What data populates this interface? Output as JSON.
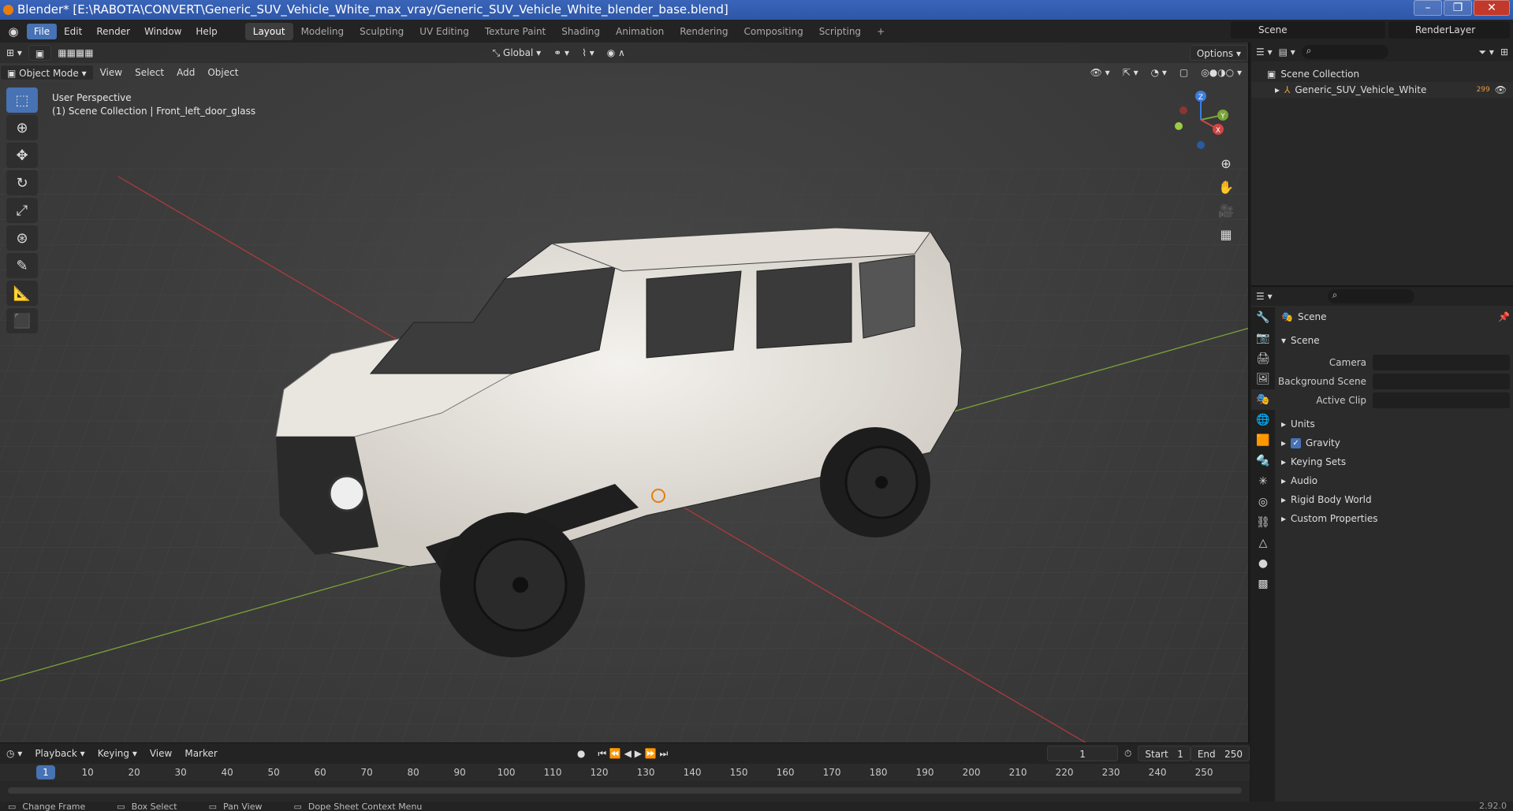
{
  "titlebar": {
    "title": "Blender* [E:\\RABOTA\\CONVERT\\Generic_SUV_Vehicle_White_max_vray/Generic_SUV_Vehicle_White_blender_base.blend]"
  },
  "menu": [
    "File",
    "Edit",
    "Render",
    "Window",
    "Help"
  ],
  "workspaces": [
    "Layout",
    "Modeling",
    "Sculpting",
    "UV Editing",
    "Texture Paint",
    "Shading",
    "Animation",
    "Rendering",
    "Compositing",
    "Scripting"
  ],
  "scene_name": "Scene",
  "render_layer": "RenderLayer",
  "viewport": {
    "mode": "Object Mode",
    "menus": [
      "View",
      "Select",
      "Add",
      "Object"
    ],
    "transform_orientation": "Global",
    "options_label": "Options",
    "perspective_label": "User Perspective",
    "collection_label": "(1) Scene Collection | Front_left_door_glass"
  },
  "gizmo": {
    "x": "X",
    "y": "Y",
    "z": "Z"
  },
  "timeline": {
    "menus": [
      "Playback",
      "Keying",
      "View",
      "Marker"
    ],
    "current_frame": "1",
    "start_label": "Start",
    "start": "1",
    "end_label": "End",
    "end": "250",
    "ticks": [
      "1",
      "10",
      "20",
      "30",
      "40",
      "50",
      "60",
      "70",
      "80",
      "90",
      "100",
      "110",
      "120",
      "130",
      "140",
      "150",
      "160",
      "170",
      "180",
      "190",
      "200",
      "210",
      "220",
      "230",
      "240",
      "250"
    ]
  },
  "statusbar": {
    "items": [
      "Change Frame",
      "Box Select",
      "Pan View",
      "Dope Sheet Context Menu"
    ],
    "version": "2.92.0"
  },
  "outliner": {
    "root": "Scene Collection",
    "items": [
      {
        "label": "Generic_SUV_Vehicle_White",
        "badge": "299"
      }
    ]
  },
  "properties": {
    "context": "Scene",
    "section": "Scene",
    "fields": [
      {
        "label": "Camera",
        "value": ""
      },
      {
        "label": "Background Scene",
        "value": ""
      },
      {
        "label": "Active Clip",
        "value": ""
      }
    ],
    "subsections": [
      "Units",
      "Gravity",
      "Keying Sets",
      "Audio",
      "Rigid Body World",
      "Custom Properties"
    ]
  }
}
